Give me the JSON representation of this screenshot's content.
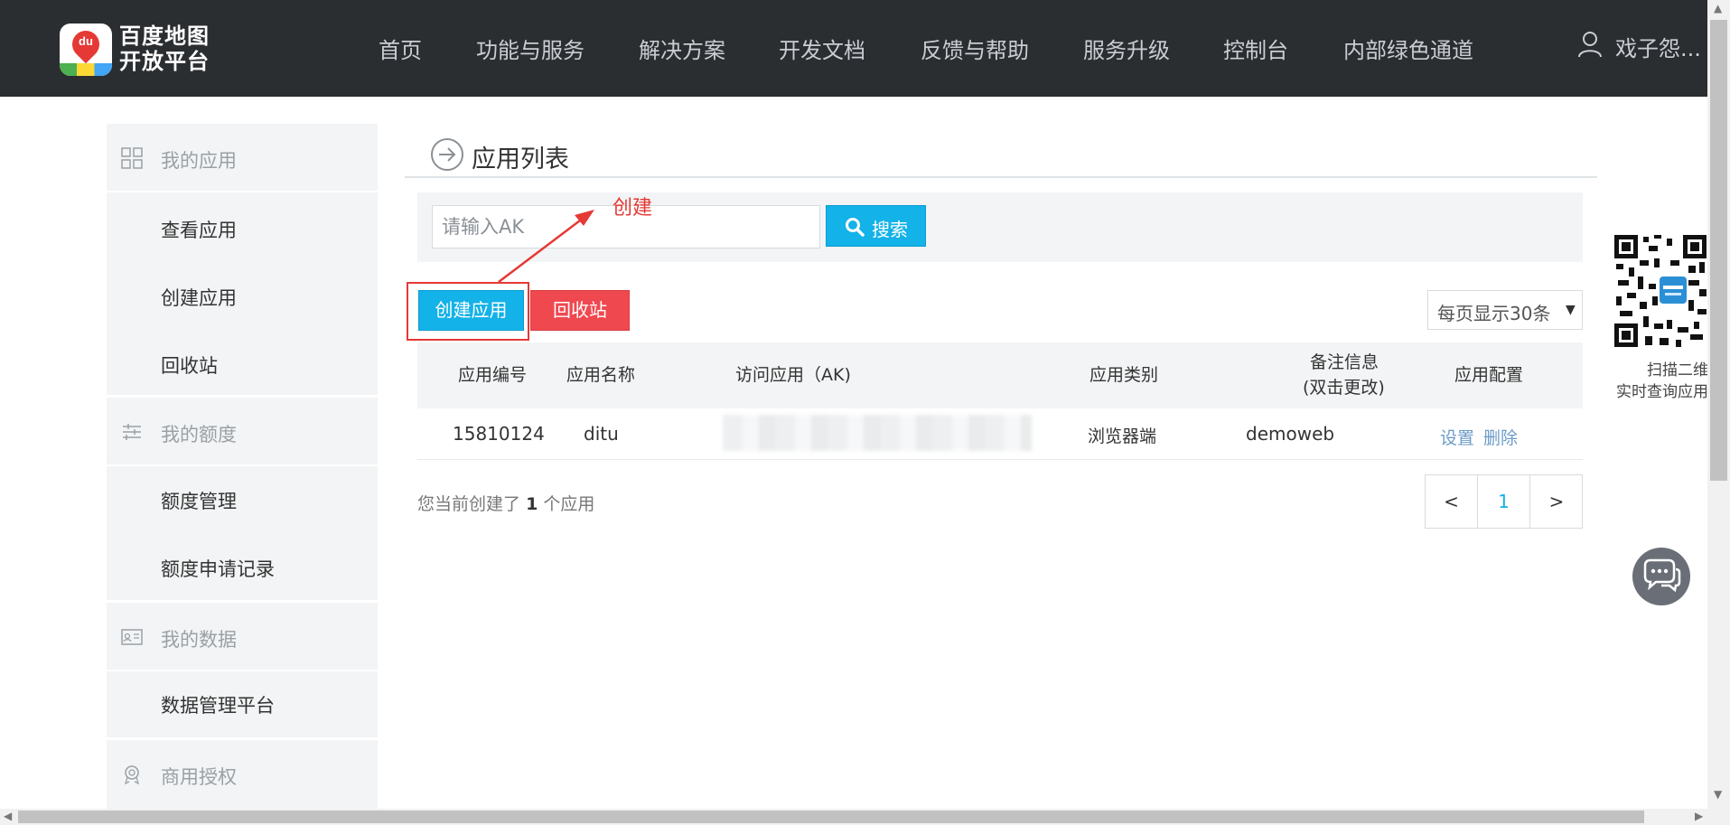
{
  "header": {
    "logo_line1": "百度地图",
    "logo_line2": "开放平台",
    "logo_badge_text": "du",
    "nav": [
      "首页",
      "功能与服务",
      "解决方案",
      "开发文档",
      "反馈与帮助",
      "服务升级",
      "控制台",
      "内部绿色通道"
    ],
    "user_name": "戏子怨..."
  },
  "sidebar": {
    "groups": [
      {
        "label": "我的应用",
        "icon": "grid-icon",
        "items": [
          "查看应用",
          "创建应用",
          "回收站"
        ]
      },
      {
        "label": "我的额度",
        "icon": "sliders-icon",
        "items": [
          "额度管理",
          "额度申请记录"
        ]
      },
      {
        "label": "我的数据",
        "icon": "id-card-icon",
        "items": [
          "数据管理平台"
        ]
      },
      {
        "label": "商用授权",
        "icon": "award-icon",
        "items": []
      }
    ]
  },
  "main": {
    "title": "应用列表",
    "search": {
      "placeholder": "请输入AK",
      "button": "搜索"
    },
    "create_button": "创建应用",
    "recycle_button": "回收站",
    "annotation": "创建",
    "page_size": "每页显示30条",
    "table": {
      "headers": [
        "应用编号",
        "应用名称",
        "访问应用（AK)",
        "应用类别",
        "备注信息",
        "(双击更改)",
        "应用配置"
      ],
      "rows": [
        {
          "id": "15810124",
          "name": "ditu",
          "type": "浏览器端",
          "note": "demoweb",
          "action_settings": "设置",
          "action_delete": "删除"
        }
      ]
    },
    "count": {
      "prefix": "您当前创建了",
      "value": "1",
      "suffix": "个应用"
    },
    "pager": {
      "prev": "<",
      "current": "1",
      "next": ">"
    }
  },
  "right": {
    "qr_line1": "扫描二维码",
    "qr_line2": "实时查询应用状"
  },
  "colors": {
    "header_bg": "#2b2e31",
    "accent_blue": "#13b2e8",
    "danger_red": "#f0484f",
    "annotation_red": "#e53935"
  }
}
